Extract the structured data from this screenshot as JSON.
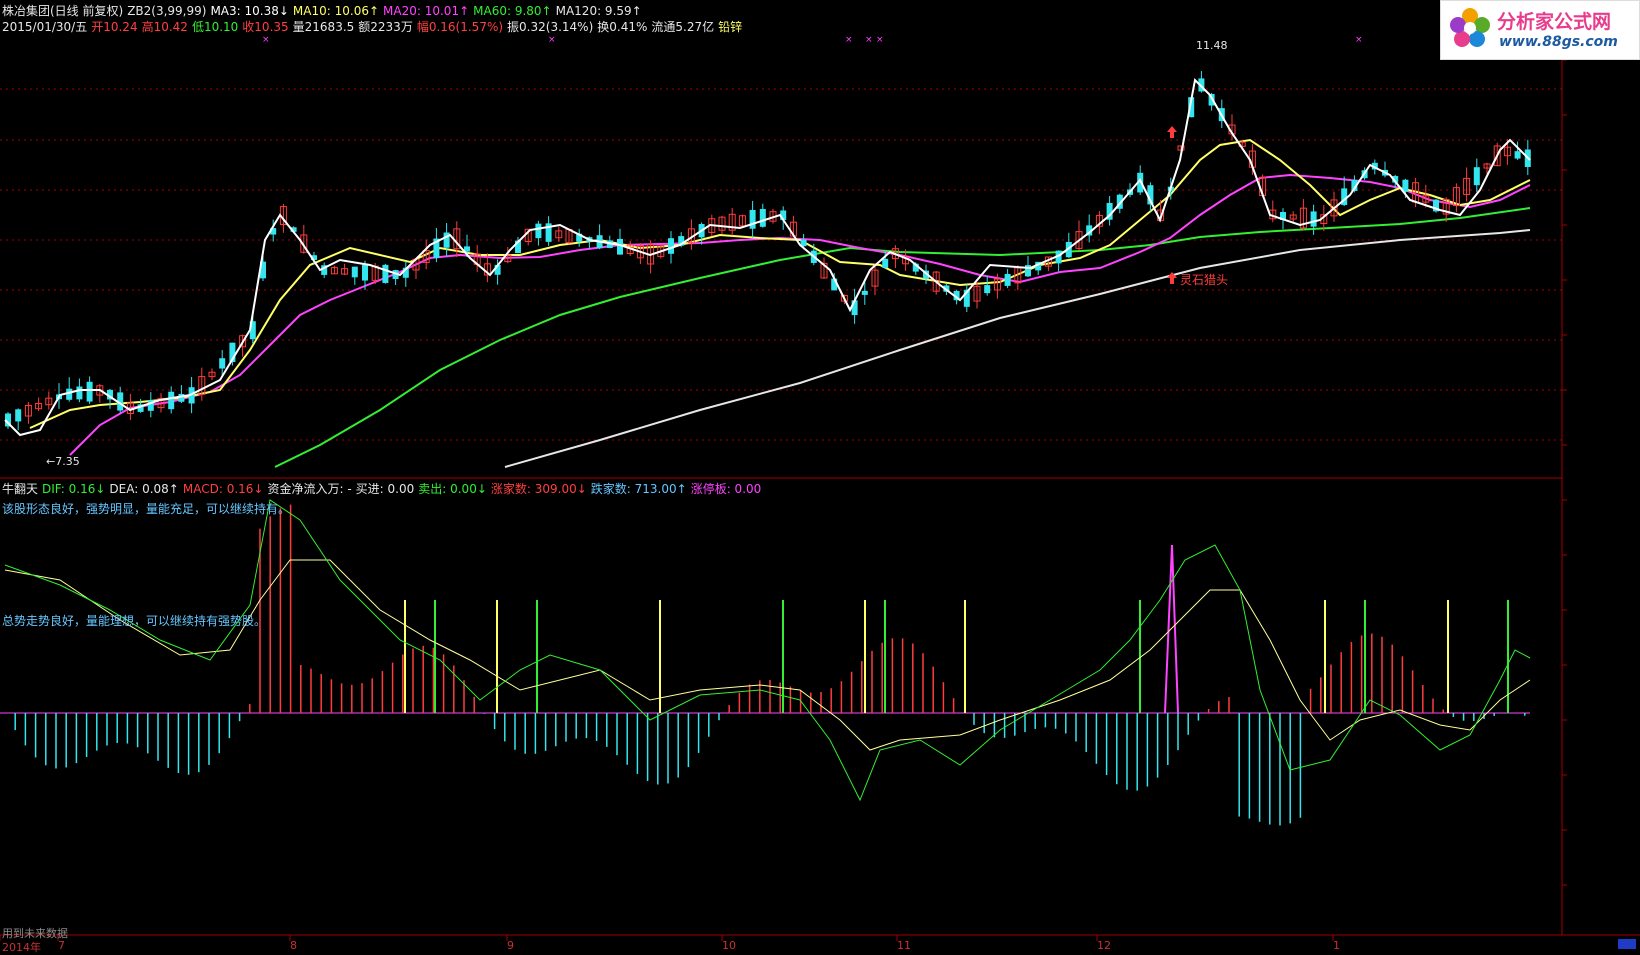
{
  "header": {
    "line1": [
      {
        "text": "株冶集团(日线 前复权)",
        "color": "#e6e6e6"
      },
      {
        "text": "ZB2(3,99,99)",
        "color": "#e6e6e6"
      },
      {
        "text": "MA3: 10.38↓",
        "color": "#ffffff"
      },
      {
        "text": "MA10: 10.06↑",
        "color": "#ffff66"
      },
      {
        "text": "MA20: 10.01↑",
        "color": "#ff44ff"
      },
      {
        "text": "MA60: 9.80↑",
        "color": "#33ee33"
      },
      {
        "text": "MA120: 9.59↑",
        "color": "#e6e6e6"
      }
    ],
    "line2": [
      {
        "text": "2015/01/30/五",
        "color": "#e6e6e6"
      },
      {
        "text": "开10.24",
        "color": "#ff4040"
      },
      {
        "text": "高10.42",
        "color": "#ff4040"
      },
      {
        "text": "低10.10",
        "color": "#33ee33"
      },
      {
        "text": "收10.35",
        "color": "#ff4040"
      },
      {
        "text": "量21683.5",
        "color": "#e6e6e6"
      },
      {
        "text": "额2233万",
        "color": "#e6e6e6"
      },
      {
        "text": "幅0.16(1.57%)",
        "color": "#ff4040"
      },
      {
        "text": "振0.32(3.14%)",
        "color": "#e6e6e6"
      },
      {
        "text": "换0.41%",
        "color": "#e6e6e6"
      },
      {
        "text": "流通5.27亿",
        "color": "#e6e6e6"
      },
      {
        "text": "铅锌",
        "color": "#ffff66"
      }
    ]
  },
  "logo": {
    "title": "分析家公式网",
    "url": "www.88gs.com"
  },
  "price_labels": {
    "high": "11.48",
    "low": "←7.35",
    "signal": "灵石猎头"
  },
  "indicator": {
    "line1": [
      {
        "text": "牛翻天",
        "color": "#e6e6e6"
      },
      {
        "text": "DIF: 0.16↓",
        "color": "#33ee33"
      },
      {
        "text": "DEA: 0.08↑",
        "color": "#e6e6e6"
      },
      {
        "text": "MACD: 0.16↓",
        "color": "#ff4040"
      },
      {
        "text": "资金净流入万: -",
        "color": "#e6e6e6"
      },
      {
        "text": "买进: 0.00",
        "color": "#e6e6e6"
      },
      {
        "text": "卖出: 0.00↓",
        "color": "#33ee33"
      },
      {
        "text": "涨家数: 309.00↓",
        "color": "#ff4040"
      },
      {
        "text": "跌家数: 713.00↑",
        "color": "#66c6ff"
      },
      {
        "text": "涨停板: 0.00",
        "color": "#ff44ff"
      }
    ],
    "comment1": "该股形态良好，强势明显，量能充足，可以继续持有。",
    "comment2": "总势走势良好，量能理想，可以继续持有强势股。"
  },
  "footer": {
    "note": "用到未来数据",
    "months": [
      "2014年",
      "7",
      "8",
      "9",
      "10",
      "11",
      "12",
      "1"
    ]
  },
  "colors": {
    "up": "#ff3c3c",
    "down": "#33e5ee",
    "ma3": "#ffffff",
    "ma10": "#ffff66",
    "ma20": "#ff44ff",
    "ma60": "#33ee33",
    "ma120": "#e6e6e6",
    "grid": "#a00000"
  },
  "chart_data": {
    "type": "line",
    "title": "株冶集团(日线 前复权)",
    "series": [
      {
        "name": "MA3",
        "last": 10.38
      },
      {
        "name": "MA10",
        "last": 10.06
      },
      {
        "name": "MA20",
        "last": 10.01
      },
      {
        "name": "MA60",
        "last": 9.8
      },
      {
        "name": "MA120",
        "last": 9.59
      }
    ],
    "high": 11.48,
    "low": 7.35,
    "last_bar": {
      "date": "2015/01/30",
      "open": 10.24,
      "high": 10.42,
      "low": 10.1,
      "close": 10.35
    }
  }
}
